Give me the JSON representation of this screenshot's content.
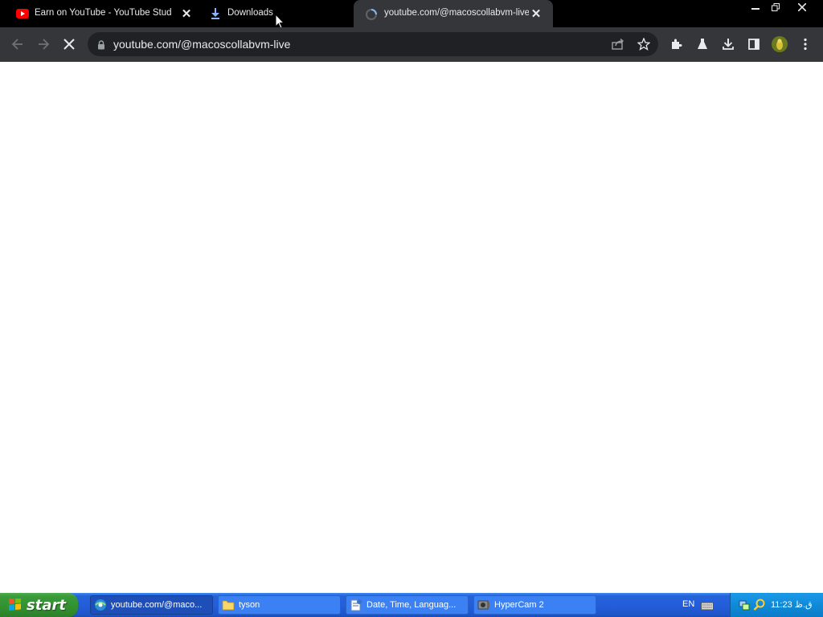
{
  "browser": {
    "tabs": [
      {
        "title": "Earn on YouTube - YouTube Studio",
        "icon": "youtube-icon",
        "active": false
      },
      {
        "title": "Downloads",
        "icon": "download-icon",
        "active": false
      },
      {
        "title": "youtube.com/@macoscollabvm-live",
        "icon": "loading-spinner-icon",
        "active": true
      }
    ],
    "url": "youtube.com/@macoscollabvm-live",
    "loading": true,
    "colors": {
      "tabstrip": "#000000",
      "toolbar": "#35363a",
      "omnibox": "#202124",
      "text": "#e8eaed"
    }
  },
  "taskbar": {
    "start_label": "start",
    "buttons": [
      {
        "label": "youtube.com/@maco...",
        "icon": "browser-icon",
        "active": true
      },
      {
        "label": "tyson",
        "icon": "folder-icon",
        "active": false
      },
      {
        "label": "Date, Time, Languag...",
        "icon": "control-panel-icon",
        "active": false
      },
      {
        "label": "HyperCam 2",
        "icon": "hypercam-icon",
        "active": false
      }
    ],
    "language": "EN",
    "clock": "11:23 ق.ظ"
  }
}
